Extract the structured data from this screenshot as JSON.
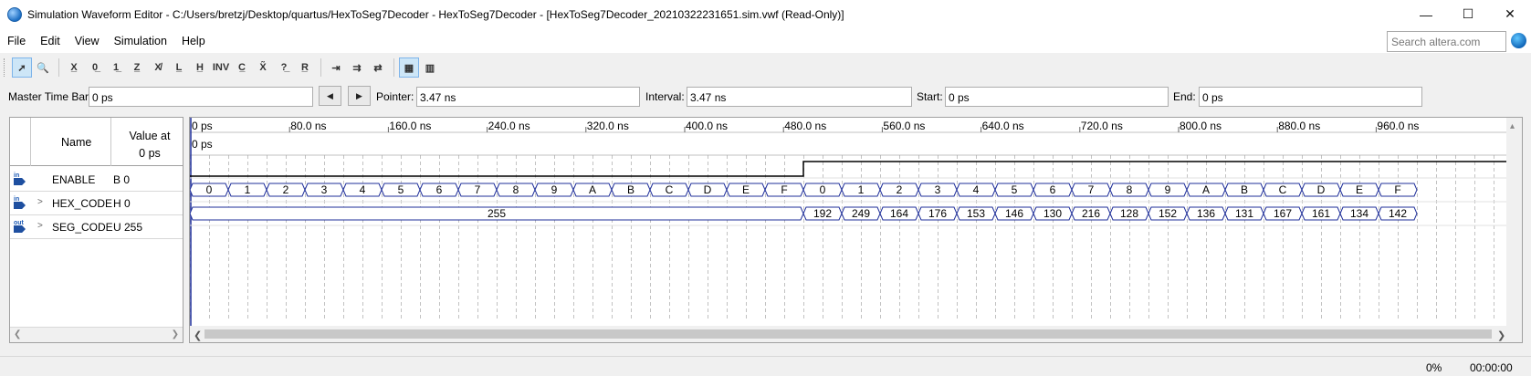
{
  "window": {
    "title": "Simulation Waveform Editor - C:/Users/bretzj/Desktop/quartus/HexToSeg7Decoder - HexToSeg7Decoder - [HexToSeg7Decoder_20210322231651.sim.vwf (Read-Only)]",
    "minimize": "—",
    "maximize": "☐",
    "close": "✕"
  },
  "menu": [
    "File",
    "Edit",
    "View",
    "Simulation",
    "Help"
  ],
  "search": {
    "placeholder": "Search altera.com"
  },
  "toolbar": {
    "buttons": [
      {
        "name": "selection-tool-icon",
        "glyph": "➚",
        "active": true
      },
      {
        "name": "zoom-tool-icon",
        "glyph": "🔍",
        "active": false
      },
      {
        "name": "force-unknown-icon",
        "glyph": "X̲",
        "active": false
      },
      {
        "name": "force-low-icon",
        "glyph": "0̲",
        "active": false
      },
      {
        "name": "force-high-icon",
        "glyph": "1̲",
        "active": false
      },
      {
        "name": "force-high-impedance-icon",
        "glyph": "Z̲",
        "active": false
      },
      {
        "name": "force-weak-unknown-icon",
        "glyph": "X̸",
        "active": false
      },
      {
        "name": "force-weak-low-icon",
        "glyph": "L̲",
        "active": false
      },
      {
        "name": "force-weak-high-icon",
        "glyph": "H̲",
        "active": false
      },
      {
        "name": "invert-icon",
        "glyph": "INV",
        "active": false
      },
      {
        "name": "count-value-icon",
        "glyph": "C̲",
        "active": false
      },
      {
        "name": "overwrite-clock-icon",
        "glyph": "X̃",
        "active": false
      },
      {
        "name": "arbitrary-value-icon",
        "glyph": "?̲",
        "active": false
      },
      {
        "name": "random-value-icon",
        "glyph": "R̲",
        "active": false
      },
      {
        "name": "snap-to-grid-icon",
        "glyph": "⇥",
        "active": false
      },
      {
        "name": "snap-transition-icon",
        "glyph": "⇉",
        "active": false
      },
      {
        "name": "stretch-icon",
        "glyph": "⇄",
        "active": false
      },
      {
        "name": "grid-icon",
        "glyph": "▦",
        "active": true
      },
      {
        "name": "settings-icon",
        "glyph": "▥",
        "active": false
      }
    ]
  },
  "timebar": {
    "master_label": "Master Time Bar:",
    "master_value": "0 ps",
    "pointer_label": "Pointer:",
    "pointer_value": "3.47 ns",
    "interval_label": "Interval:",
    "interval_value": "3.47 ns",
    "start_label": "Start:",
    "start_value": "0 ps",
    "end_label": "End:",
    "end_value": "0 ps",
    "prev": "◀",
    "next": "▶"
  },
  "signals_header": {
    "name": "Name",
    "value_line1": "Value at",
    "value_line2": "0 ps"
  },
  "signals": [
    {
      "icon": "input",
      "badge": "in",
      "expandable": false,
      "name": "ENABLE",
      "value": "B 0"
    },
    {
      "icon": "input",
      "badge": "in",
      "expandable": true,
      "name": "HEX_CODE",
      "value": "H 0"
    },
    {
      "icon": "output",
      "badge": "out",
      "expandable": true,
      "name": "SEG_CODE",
      "value": "U 255"
    }
  ],
  "ruler": {
    "labels": [
      "0 ps",
      "80.0 ns",
      "160.0 ns",
      "240.0 ns",
      "320.0 ns",
      "400.0 ns",
      "480.0 ns",
      "560.0 ns",
      "640.0 ns",
      "720.0 ns",
      "800.0 ns",
      "880.0 ns",
      "960.0 ns"
    ],
    "time_bar_label": "0 ps"
  },
  "waves": {
    "enable": {
      "high_from_slot": 16
    },
    "hex": [
      "0",
      "1",
      "2",
      "3",
      "4",
      "5",
      "6",
      "7",
      "8",
      "9",
      "A",
      "B",
      "C",
      "D",
      "E",
      "F",
      "0",
      "1",
      "2",
      "3",
      "4",
      "5",
      "6",
      "7",
      "8",
      "9",
      "A",
      "B",
      "C",
      "D",
      "E",
      "F"
    ],
    "seg_first": "255",
    "seg": [
      "192",
      "249",
      "164",
      "176",
      "153",
      "146",
      "130",
      "216",
      "128",
      "152",
      "136",
      "131",
      "167",
      "161",
      "134",
      "142"
    ]
  },
  "colors": {
    "wave": "#1f2f9a",
    "grid": "#9a9a9a",
    "enable": "#000000"
  },
  "status": {
    "percent": "0%",
    "time": "00:00:00"
  }
}
